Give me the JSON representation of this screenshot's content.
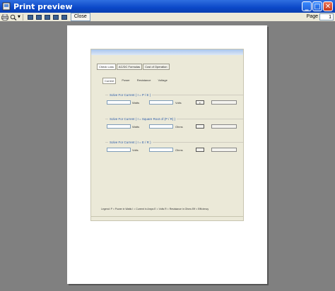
{
  "window": {
    "title": "Print preview",
    "min": "_",
    "max": "□",
    "close": "✕"
  },
  "toolbar": {
    "print_icon": "printer-icon",
    "zoom_icon": "zoom-icon",
    "close_label": "Close",
    "page_label": "Page",
    "page_value": "1"
  },
  "form": {
    "tabs_top": [
      "Check Loss",
      "AC/DC Formulas",
      "Cost of Operation"
    ],
    "tabs_sub": [
      "Current",
      "Power",
      "Resistance",
      "Voltage"
    ],
    "groups": [
      {
        "title": "Solve For Current    ( I = P / E )",
        "unit1": "Watts",
        "unit2": "Volts"
      },
      {
        "title": "Solve For Current    ( I = Square Root of (P / R) )",
        "unit1": "Watts",
        "unit2": "Ohms"
      },
      {
        "title": "Solve For Current    ( I = E / R )",
        "unit1": "Volts",
        "unit2": "Ohms"
      }
    ],
    "legend": "Legend:     P = Power in Watts     I = Current in Amps     E = Volts     R = Resistance in Ohms     Eff = Efficiency"
  }
}
